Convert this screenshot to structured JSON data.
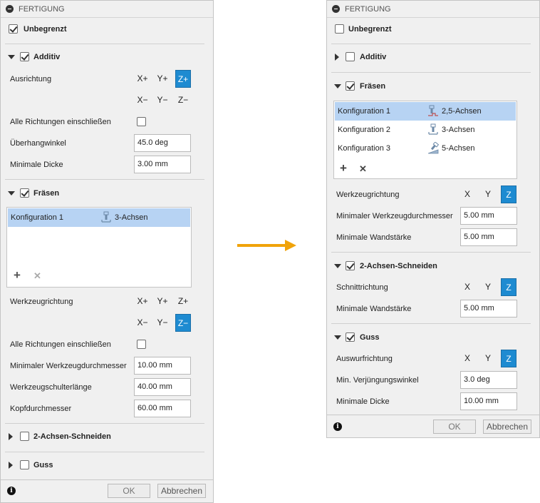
{
  "left": {
    "title": "FERTIGUNG",
    "unbegrenzt": "Unbegrenzt",
    "additiv": {
      "label": "Additiv",
      "ausrichtung": "Ausrichtung",
      "axes_top": [
        "X+",
        "Y+",
        "Z+"
      ],
      "axes_bottom": [
        "X−",
        "Y−",
        "Z−"
      ],
      "alle": "Alle Richtungen einschließen",
      "ueberhang_label": "Überhangwinkel",
      "ueberhang_value": "45.0 deg",
      "dicke_label": "Minimale Dicke",
      "dicke_value": "3.00 mm"
    },
    "fraesen": {
      "label": "Fräsen",
      "config_name": "Konfiguration 1",
      "config_type": "3-Achsen",
      "werkzeug": "Werkzeugrichtung",
      "axes_top": [
        "X+",
        "Y+",
        "Z+"
      ],
      "axes_bottom": [
        "X−",
        "Y−",
        "Z−"
      ],
      "alle": "Alle Richtungen einschließen",
      "dm_label": "Minimaler Werkzeugdurchmesser",
      "dm_value": "10.00 mm",
      "schulter_label": "Werkzeugschulterlänge",
      "schulter_value": "40.00 mm",
      "kopf_label": "Kopfdurchmesser",
      "kopf_value": "60.00 mm"
    },
    "schneiden": "2-Achsen-Schneiden",
    "guss": "Guss",
    "ok": "OK",
    "abbrechen": "Abbrechen"
  },
  "right": {
    "title": "FERTIGUNG",
    "unbegrenzt": "Unbegrenzt",
    "additiv": "Additiv",
    "fraesen": {
      "label": "Fräsen",
      "configs": [
        {
          "name": "Konfiguration 1",
          "type": "2,5-Achsen"
        },
        {
          "name": "Konfiguration 2",
          "type": "3-Achsen"
        },
        {
          "name": "Konfiguration 3",
          "type": "5-Achsen"
        }
      ],
      "werkzeug": "Werkzeugrichtung",
      "axes": [
        "X",
        "Y",
        "Z"
      ],
      "dm_label": "Minimaler Werkzeugdurchmesser",
      "dm_value": "5.00 mm",
      "wand_label": "Minimale Wandstärke",
      "wand_value": "5.00 mm"
    },
    "schneiden": {
      "label": "2-Achsen-Schneiden",
      "schnitt": "Schnittrichtung",
      "axes": [
        "X",
        "Y",
        "Z"
      ],
      "wand_label": "Minimale Wandstärke",
      "wand_value": "5.00 mm"
    },
    "guss": {
      "label": "Guss",
      "auswurf": "Auswurfrichtung",
      "axes": [
        "X",
        "Y",
        "Z"
      ],
      "winkel_label": "Min. Verjüngungswinkel",
      "winkel_value": "3.0 deg",
      "dicke_label": "Minimale Dicke",
      "dicke_value": "10.00 mm"
    },
    "ok": "OK",
    "abbrechen": "Abbrechen"
  },
  "colors": {
    "accent": "#1e8bd1",
    "selection": "#b7d3f3",
    "arrow": "#f0a30a"
  }
}
